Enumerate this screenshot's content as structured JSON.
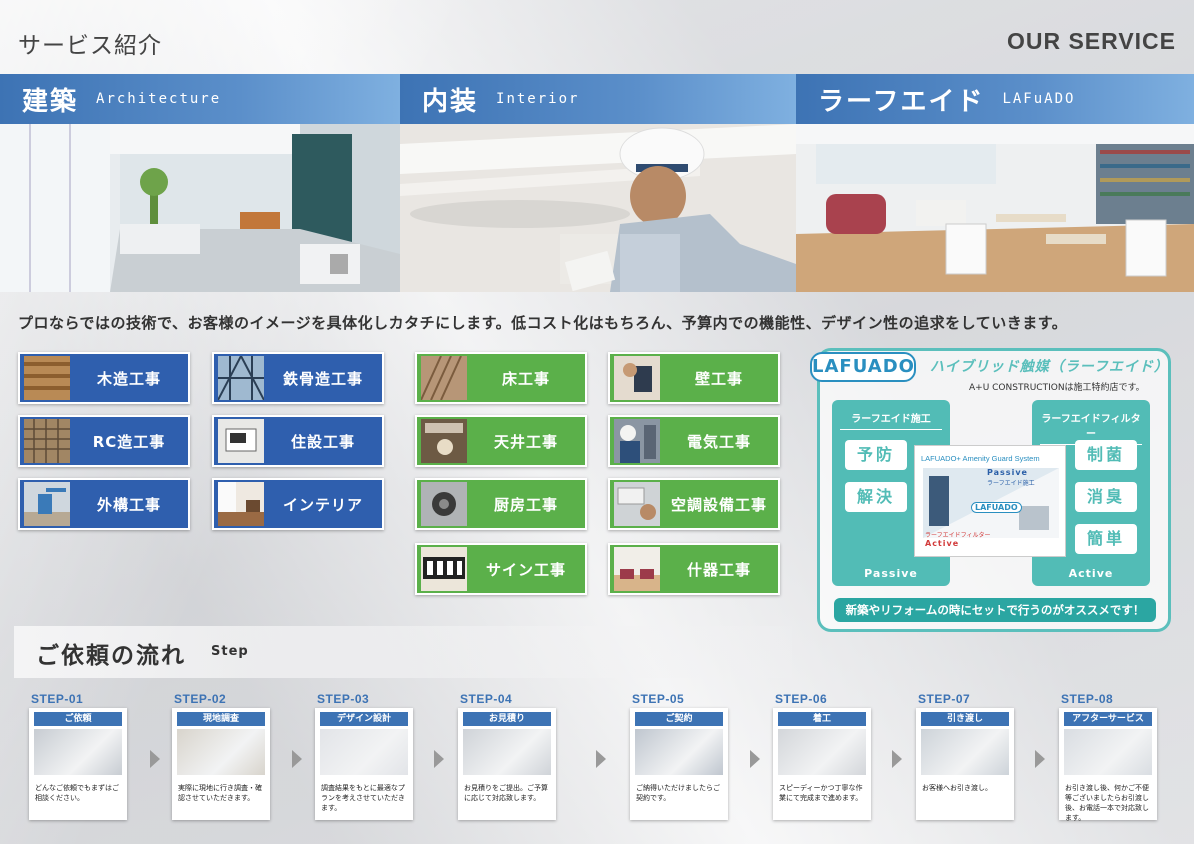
{
  "header": {
    "title": "サービス紹介",
    "title_en": "OUR SERVICE"
  },
  "services": [
    {
      "jp": "建築",
      "en": "Architecture"
    },
    {
      "jp": "内装",
      "en": "Interior"
    },
    {
      "jp": "ラーフエイド",
      "en": "LAFuADO"
    }
  ],
  "tagline": "プロならではの技術で、お客様のイメージを具体化しカタチにします。低コスト化はもちろん、予算内での機能性、デザイン性の追求をしていきます。",
  "works_arch": [
    "木造工事",
    "鉄骨造工事",
    "RC造工事",
    "住設工事",
    "外構工事",
    "インテリア"
  ],
  "works_interior": [
    "床工事",
    "壁工事",
    "天井工事",
    "電気工事",
    "厨房工事",
    "空調設備工事",
    "サイン工事",
    "什器工事"
  ],
  "lafuado": {
    "logo": "LAFUADO",
    "heading": "ハイブリッド触媒（ラーフエイド）",
    "sub": "A+U CONSTRUCTIONは施工特約店です。",
    "left_caption": "ラーフエイド施工",
    "left_items": [
      "予防",
      "解決"
    ],
    "left_footer": "Passive",
    "right_caption": "ラーフエイドフィルター",
    "right_items": [
      "制菌",
      "消臭",
      "簡単"
    ],
    "right_footer": "Active",
    "card_title": "LAFUADO+ Amenity Guard System",
    "card_passive": "Passive",
    "card_passive_sub": "ラーフエイド施工",
    "card_logo": "LAFUADO",
    "card_active_sub": "ラーフエイドフィルター",
    "card_active": "Active",
    "banner": "新築やリフォームの時にセットで行うのがオススメです！"
  },
  "flow": {
    "title": "ご依頼の流れ",
    "title_en": "Step",
    "steps": [
      {
        "step": "STEP-01",
        "title": "ご依頼",
        "text": "どんなご依頼でもまずはご相談ください。"
      },
      {
        "step": "STEP-02",
        "title": "現地調査",
        "text": "実際に現地に行き調査・確認させていただきます。"
      },
      {
        "step": "STEP-03",
        "title": "デザイン設計",
        "text": "調査結果をもとに最適なプランを考えさせていただきます。"
      },
      {
        "step": "STEP-04",
        "title": "お見積り",
        "text": "お見積りをご提出。ご予算に応じて対応致します。"
      },
      {
        "step": "STEP-05",
        "title": "ご契約",
        "text": "ご納得いただけましたらご契約です。"
      },
      {
        "step": "STEP-06",
        "title": "着工",
        "text": "スピーディーかつ丁寧な作業にて完成まで進めます。"
      },
      {
        "step": "STEP-07",
        "title": "引き渡し",
        "text": "お客様へお引き渡し。"
      },
      {
        "step": "STEP-08",
        "title": "アフターサービス",
        "text": "お引き渡し後、何かご不便等ございましたらお引渡し後、お電話一本で対応致します。"
      }
    ]
  },
  "colors": {
    "blue": "#2f5fae",
    "green": "#5bb04a",
    "teal": "#52bcb6",
    "band": "#3d73b4"
  }
}
